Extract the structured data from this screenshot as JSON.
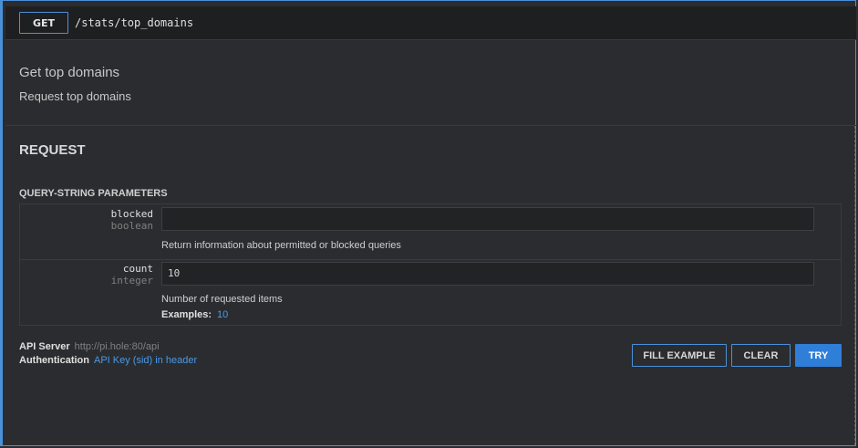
{
  "endpoint": {
    "method": "GET",
    "path": "/stats/top_domains",
    "summary": "Get top domains",
    "description": "Request top domains"
  },
  "request": {
    "title": "REQUEST",
    "params_title": "QUERY-STRING PARAMETERS",
    "params": [
      {
        "name": "blocked",
        "type": "boolean",
        "value": "",
        "description": "Return information about permitted or blocked queries"
      },
      {
        "name": "count",
        "type": "integer",
        "value": "10",
        "description": "Number of requested items",
        "examples_label": "Examples:",
        "examples_value": "10"
      }
    ]
  },
  "footer": {
    "server_label": "API Server",
    "server_value": "http://pi.hole:80/api",
    "auth_label": "Authentication",
    "auth_value": "API Key (sid) in header"
  },
  "buttons": {
    "fill_example": "FILL EXAMPLE",
    "clear": "CLEAR",
    "try": "TRY"
  },
  "colors": {
    "accent": "#4a90d9",
    "try_button": "#2f7fd8",
    "link": "#4a9ae8",
    "background": "#2b2c2f",
    "header_background": "#1e1f21"
  }
}
